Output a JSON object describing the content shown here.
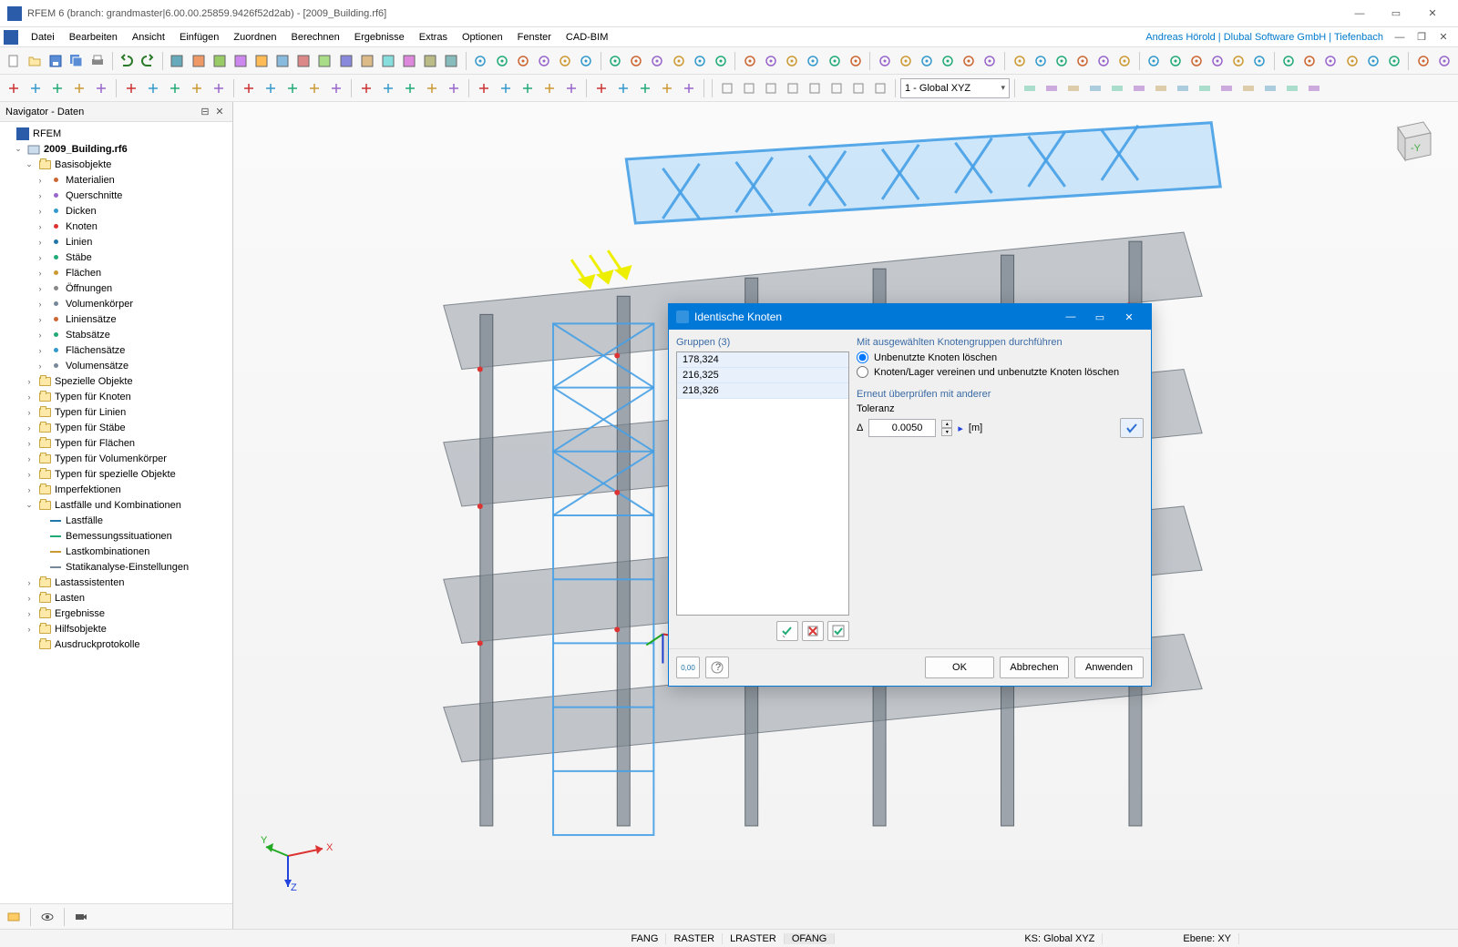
{
  "window": {
    "title": "RFEM 6 (branch: grandmaster|6.00.00.25859.9426f52d2ab) - [2009_Building.rf6]"
  },
  "menu": {
    "items": [
      "Datei",
      "Bearbeiten",
      "Ansicht",
      "Einfügen",
      "Zuordnen",
      "Berechnen",
      "Ergebnisse",
      "Extras",
      "Optionen",
      "Fenster",
      "CAD-BIM"
    ],
    "user": "Andreas Hörold | Dlubal Software GmbH | Tiefenbach"
  },
  "toolbar_select": "1 - Global XYZ",
  "navigator": {
    "title": "Navigator - Daten",
    "root": "RFEM",
    "project": "2009_Building.rf6",
    "basisobjekte": "Basisobjekte",
    "basis_children": [
      "Materialien",
      "Querschnitte",
      "Dicken",
      "Knoten",
      "Linien",
      "Stäbe",
      "Flächen",
      "Öffnungen",
      "Volumenkörper",
      "Liniensätze",
      "Stabsätze",
      "Flächensätze",
      "Volumensätze"
    ],
    "spezielle": "Spezielle Objekte",
    "typ_knoten": "Typen für Knoten",
    "typ_linien": "Typen für Linien",
    "typ_staebe": "Typen für Stäbe",
    "typ_flaechen": "Typen für Flächen",
    "typ_volumen": "Typen für Volumenkörper",
    "typ_spez": "Typen für spezielle Objekte",
    "imperf": "Imperfektionen",
    "lastfaelle_komb": "Lastfälle und Kombinationen",
    "lk_children": [
      "Lastfälle",
      "Bemessungssituationen",
      "Lastkombinationen",
      "Statikanalyse-Einstellungen"
    ],
    "lastassist": "Lastassistenten",
    "lasten": "Lasten",
    "ergebnisse": "Ergebnisse",
    "hilfs": "Hilfsobjekte",
    "ausdruck": "Ausdruckprotokolle"
  },
  "dialog": {
    "title": "Identische Knoten",
    "gruppen_label": "Gruppen (3)",
    "gruppen": [
      "178,324",
      "216,325",
      "218,326"
    ],
    "right_head": "Mit ausgewählten Knotengruppen durchführen",
    "opt1": "Unbenutzte Knoten löschen",
    "opt2": "Knoten/Lager vereinen und unbenutzte Knoten löschen",
    "recheck": "Erneut überprüfen mit anderer",
    "tol_label": "Toleranz",
    "delta": "Δ",
    "tol_value": "0.0050",
    "unit": "[m]",
    "ok": "OK",
    "cancel": "Abbrechen",
    "apply": "Anwenden"
  },
  "status": {
    "snap": [
      "FANG",
      "RASTER",
      "LRASTER",
      "OFANG"
    ],
    "ks_label": "KS:",
    "ks_value": "Global XYZ",
    "ebene_label": "Ebene:",
    "ebene_value": "XY"
  },
  "axis": {
    "x": "X",
    "y": "Y",
    "z": "Z"
  }
}
